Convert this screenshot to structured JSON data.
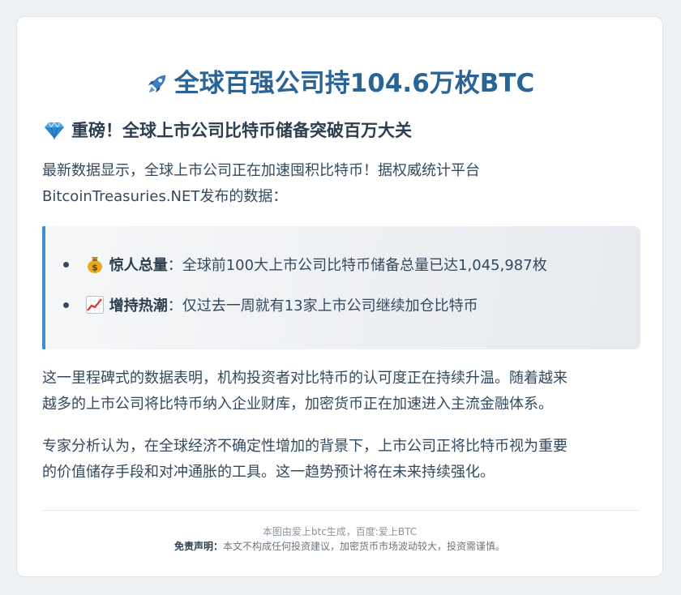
{
  "title": "全球百强公司持104.6万枚BTC",
  "subtitle": "重磅！全球上市公司比特币储备突破百万大关",
  "intro_line1": "最新数据显示，全球上市公司正在加速囤积比特币！据权威统计平台",
  "intro_line2": "BitcoinTreasuries.NET发布的数据：",
  "highlights": [
    {
      "icon": "money-bag-icon",
      "label": "惊人总量",
      "sep": "：",
      "text": "全球前100大上市公司比特币储备总量已达1,045,987枚"
    },
    {
      "icon": "chart-up-icon",
      "label": "增持热潮",
      "sep": "：",
      "text": "仅过去一周就有13家上市公司继续加仓比特币"
    }
  ],
  "para2_line1": "这一里程碑式的数据表明，机构投资者对比特币的认可度正在持续升温。随着越来",
  "para2_line2": "越多的上市公司将比特币纳入企业财库，加密货币正在加速进入主流金融体系。",
  "para3_line1": "专家分析认为，在全球经济不确定性增加的背景下，上市公司正将比特币视为重要",
  "para3_line2": "的价值储存手段和对冲通胀的工具。这一趋势预计将在未来持续强化。",
  "footer": {
    "source": "本图由爱上btc生成，百度:爱上BTC",
    "disclaimer_label": "免责声明：",
    "disclaimer_text": "本文不构成任何投资建议，加密货币市场波动较大，投资需谨慎。"
  },
  "colors": {
    "title": "#2a6496",
    "accent_border": "#3b8ed6",
    "text": "#34495e"
  }
}
